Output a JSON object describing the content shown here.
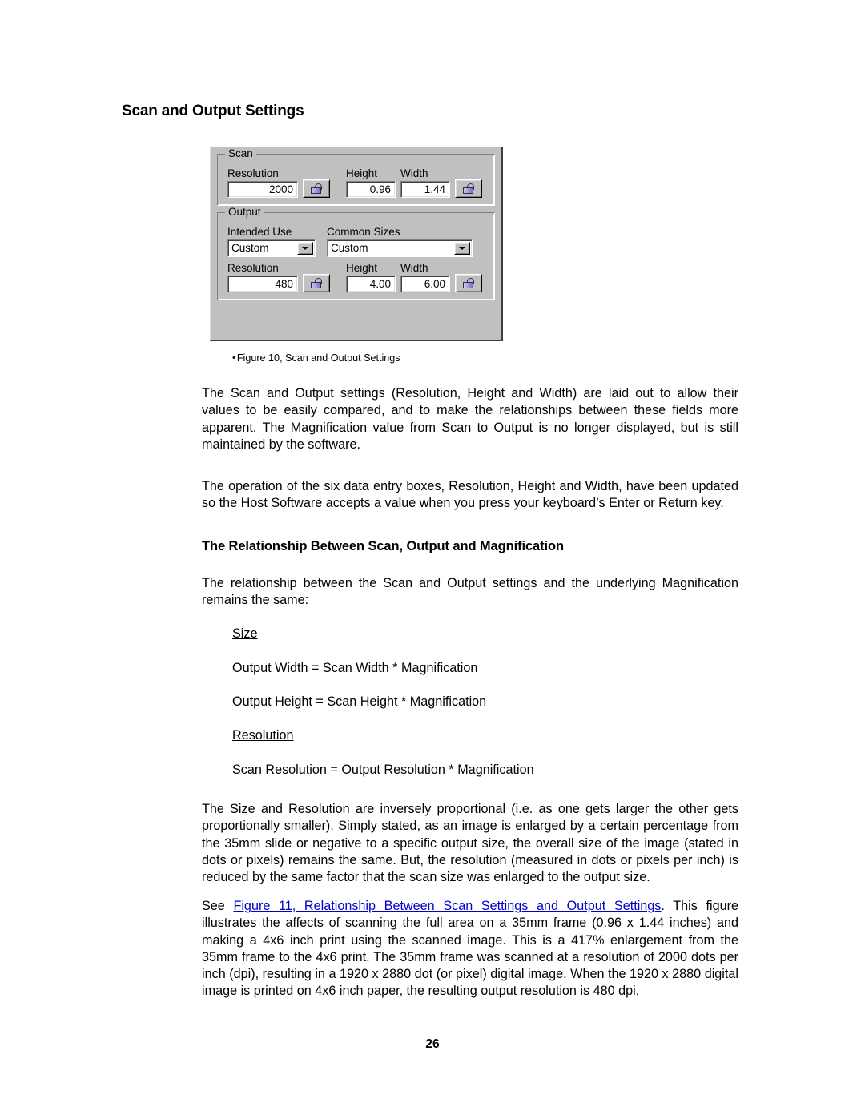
{
  "document": {
    "page_number": "26",
    "heading": "Scan and Output Settings",
    "subheading": "The Relationship Between Scan, Output and Magnification",
    "figure_caption": "Figure 10, Scan and Output Settings",
    "caption_bullet": "•"
  },
  "figure": {
    "scan_group": {
      "legend": "Scan",
      "resolution_label": "Resolution",
      "resolution_value": "2000",
      "height_label": "Height",
      "height_value": "0.96",
      "width_label": "Width",
      "width_value": "1.44",
      "lock_left_name": "padlock-open",
      "lock_right_name": "padlock-open"
    },
    "output_group": {
      "legend": "Output",
      "intended_use_label": "Intended Use",
      "intended_use_value": "Custom",
      "common_sizes_label": "Common Sizes",
      "common_sizes_value": "Custom",
      "resolution_label": "Resolution",
      "resolution_value": "480",
      "height_label": "Height",
      "height_value": "4.00",
      "width_label": "Width",
      "width_value": "6.00",
      "lock_left_name": "padlock-open",
      "lock_right_name": "padlock-open"
    }
  },
  "body": {
    "para1": "The Scan and Output settings (Resolution, Height and Width) are laid out to allow their values to be easily compared, and to make the relationships between these fields more apparent.  The Magnification value from Scan to Output is no longer displayed, but is still maintained by the software.",
    "para2": "The operation of the six data entry boxes, Resolution, Height and Width, have been updated so the Host Software accepts a value when you press your keyboard’s Enter or Return key.",
    "para3": "The relationship between the Scan and Output settings and the underlying Magnification remains the same:",
    "size_label": "Size",
    "formula_width": "Output Width = Scan Width * Magnification",
    "formula_height": "Output Height = Scan Height * Magnification",
    "resolution_label": "Resolution",
    "formula_resolution": "Scan Resolution = Output Resolution * Magnification",
    "para4": "The Size and Resolution are inversely proportional (i.e. as one gets larger the other gets proportionally smaller).  Simply stated, as an image is enlarged by a certain percentage from the 35mm slide or negative to a specific output size, the overall size of the image (stated in dots or pixels) remains the same.  But, the resolution (measured in dots or pixels per inch) is reduced by the same factor that the scan size was enlarged to the output size.",
    "para5_prefix": "See ",
    "para5_link": "Figure 11, Relationship Between Scan Settings and Output Settings",
    "para5_suffix": ". This figure illustrates the affects of scanning the full area on a 35mm frame (0.96 x 1.44 inches) and making a 4x6 inch print using the scanned image.  This is a 417% enlargement from the 35mm frame to the 4x6 print.  The 35mm frame was scanned at a resolution of 2000 dots per inch (dpi), resulting in a 1920 x 2880 dot (or pixel) digital image.  When the 1920 x 2880 digital image is printed on 4x6 inch paper, the resulting output resolution is 480 dpi,"
  },
  "colors": {
    "link": "#0000cc",
    "dialog_face": "#c0c0c0",
    "text": "#000000"
  }
}
